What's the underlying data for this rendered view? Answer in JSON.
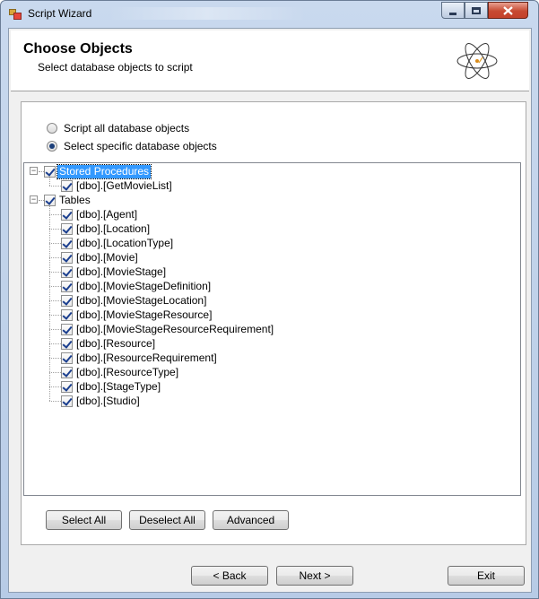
{
  "window": {
    "title": "Script Wizard"
  },
  "header": {
    "title": "Choose Objects",
    "subtitle": "Select database objects to script"
  },
  "options": {
    "script_all": "Script all database objects",
    "select_specific": "Select specific database objects",
    "selected": "select_specific"
  },
  "tree": {
    "groups": [
      {
        "label": "Stored Procedures",
        "checked": true,
        "expanded": true,
        "selected": true,
        "items": [
          "[dbo].[GetMovieList]"
        ]
      },
      {
        "label": "Tables",
        "checked": true,
        "expanded": true,
        "selected": false,
        "items": [
          "[dbo].[Agent]",
          "[dbo].[Location]",
          "[dbo].[LocationType]",
          "[dbo].[Movie]",
          "[dbo].[MovieStage]",
          "[dbo].[MovieStageDefinition]",
          "[dbo].[MovieStageLocation]",
          "[dbo].[MovieStageResource]",
          "[dbo].[MovieStageResourceRequirement]",
          "[dbo].[Resource]",
          "[dbo].[ResourceRequirement]",
          "[dbo].[ResourceType]",
          "[dbo].[StageType]",
          "[dbo].[Studio]"
        ]
      }
    ]
  },
  "selection_buttons": {
    "select_all": "Select All",
    "deselect_all": "Deselect All",
    "advanced": "Advanced"
  },
  "nav_buttons": {
    "back": "< Back",
    "next": "Next >",
    "exit": "Exit"
  }
}
